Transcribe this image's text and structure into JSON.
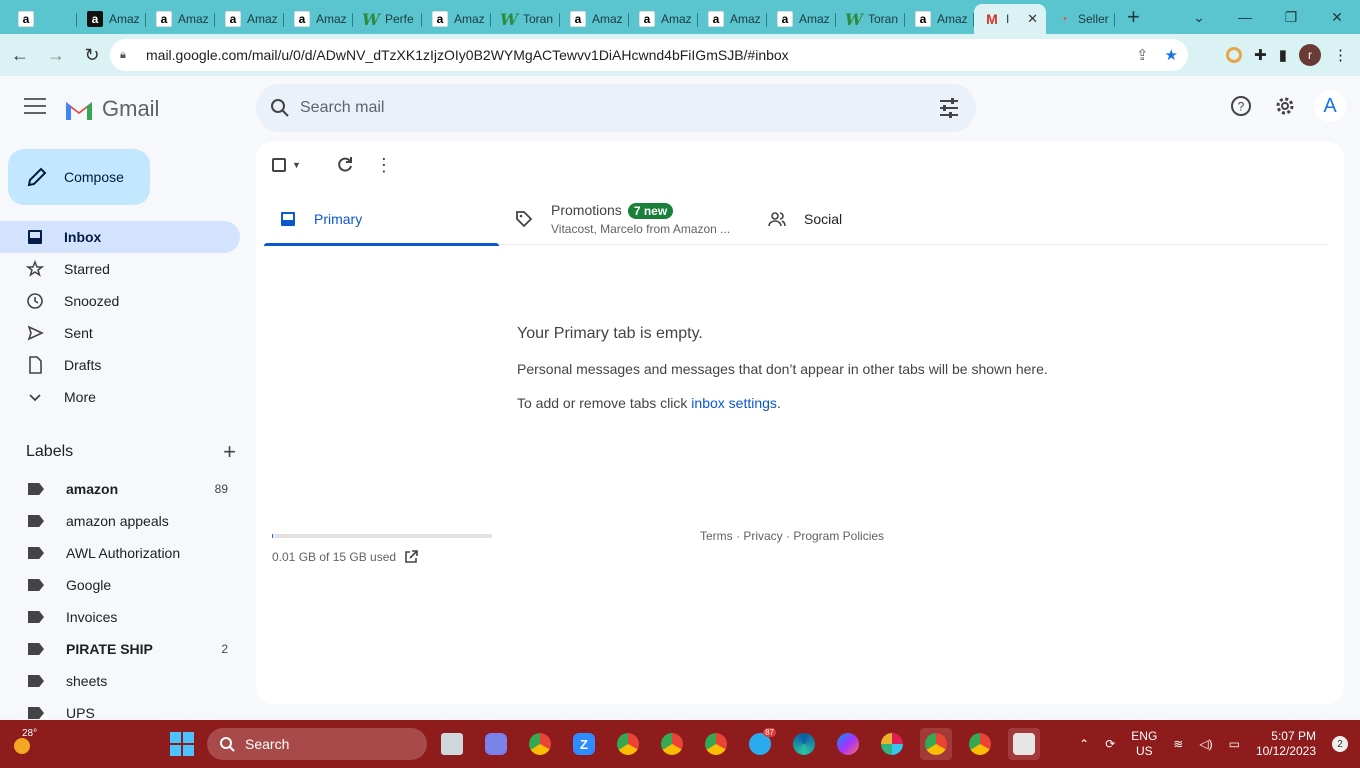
{
  "browser": {
    "tabs": [
      {
        "label": "",
        "icon": "amazon-icon",
        "active": false
      },
      {
        "label": "Amaz",
        "icon": "amazon-dark-icon",
        "active": false
      },
      {
        "label": "Amaz",
        "icon": "amazon-icon",
        "active": false
      },
      {
        "label": "Amaz",
        "icon": "amazon-icon",
        "active": false
      },
      {
        "label": "Amaz",
        "icon": "amazon-icon",
        "active": false
      },
      {
        "label": "Perfe",
        "icon": "w-icon",
        "active": false
      },
      {
        "label": "Amaz",
        "icon": "amazon-icon",
        "active": false
      },
      {
        "label": "Toran",
        "icon": "w-icon",
        "active": false
      },
      {
        "label": "Amaz",
        "icon": "amazon-icon",
        "active": false
      },
      {
        "label": "Amaz",
        "icon": "amazon-icon",
        "active": false
      },
      {
        "label": "Amaz",
        "icon": "amazon-icon",
        "active": false
      },
      {
        "label": "Amaz",
        "icon": "amazon-icon",
        "active": false
      },
      {
        "label": "Toran",
        "icon": "w-icon",
        "active": false
      },
      {
        "label": "Amaz",
        "icon": "amazon-icon",
        "active": false
      },
      {
        "label": "I",
        "icon": "gmail-icon",
        "active": true
      },
      {
        "label": "Seller",
        "icon": "seller-icon",
        "active": false
      }
    ],
    "url": "mail.google.com/mail/u/0/d/ADwNV_dTzXK1zIjzOIy0B2WYMgACTewvv1DiAHcwnd4bFiIGmSJB/#inbox",
    "profile_initial": "r"
  },
  "gmail": {
    "logo_text": "Gmail",
    "search_placeholder": "Search mail",
    "account_initial": "A",
    "compose_label": "Compose",
    "nav": [
      {
        "label": "Inbox",
        "icon": "inbox-icon",
        "active": true
      },
      {
        "label": "Starred",
        "icon": "star-icon",
        "active": false
      },
      {
        "label": "Snoozed",
        "icon": "clock-icon",
        "active": false
      },
      {
        "label": "Sent",
        "icon": "send-icon",
        "active": false
      },
      {
        "label": "Drafts",
        "icon": "draft-icon",
        "active": false
      },
      {
        "label": "More",
        "icon": "chevron-down-icon",
        "active": false
      }
    ],
    "labels_title": "Labels",
    "labels": [
      {
        "name": "amazon",
        "count": "89",
        "bold": true
      },
      {
        "name": "amazon appeals",
        "count": "",
        "bold": false
      },
      {
        "name": "AWL Authorization",
        "count": "",
        "bold": false
      },
      {
        "name": "Google",
        "count": "",
        "bold": false
      },
      {
        "name": "Invoices",
        "count": "",
        "bold": false
      },
      {
        "name": "PIRATE SHIP",
        "count": "2",
        "bold": true
      },
      {
        "name": "sheets",
        "count": "",
        "bold": false
      },
      {
        "name": "UPS",
        "count": "",
        "bold": false
      }
    ],
    "tabs": {
      "primary": "Primary",
      "promotions": "Promotions",
      "promotions_badge": "7 new",
      "promotions_sub": "Vitacost, Marcelo from Amazon ...",
      "social": "Social"
    },
    "empty": {
      "title": "Your Primary tab is empty.",
      "message": "Personal messages and messages that don’t appear in other tabs will be shown here.",
      "tip_prefix": "To add or remove tabs click ",
      "tip_link": "inbox settings",
      "tip_suffix": "."
    },
    "storage": {
      "text": "0.01 GB of 15 GB used",
      "fraction": 0.0007
    },
    "footer": "Terms · Privacy · Program Policies"
  },
  "taskbar": {
    "temperature": "28°",
    "search_label": "Search",
    "language": "ENG",
    "region": "US",
    "time": "5:07 PM",
    "date": "10/12/2023",
    "notification_count": "2",
    "telegram_badge": "87"
  },
  "colors": {
    "tab_strip": "#5ac4cf",
    "taskbar": "#8e1c1c",
    "compose": "#c2e7ff",
    "active_nav": "#d3e3fd",
    "accent": "#0b57d0",
    "badge": "#188038"
  }
}
